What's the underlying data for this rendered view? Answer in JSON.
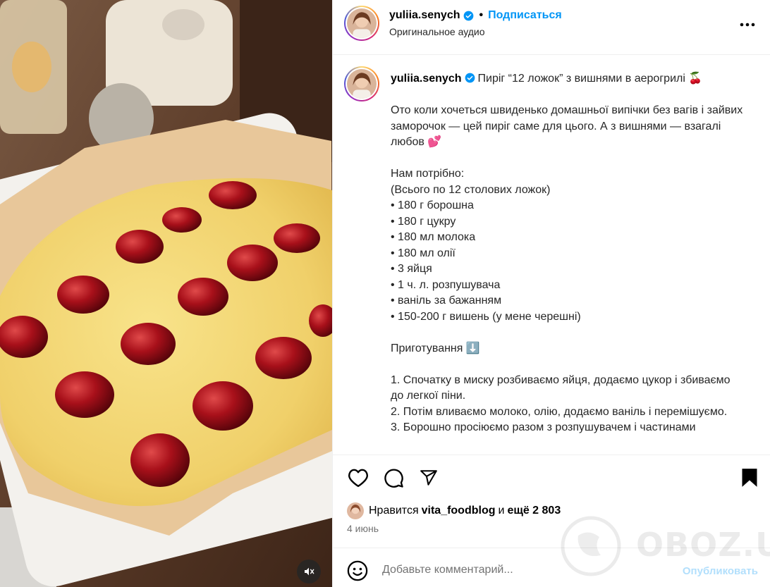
{
  "post": {
    "username": "yuliia.senych",
    "verified": true,
    "separator": "•",
    "follow_label": "Подписаться",
    "audio_label": "Оригинальное аудио",
    "more_icon": "more-horizontal-icon"
  },
  "caption": {
    "username": "yuliia.senych",
    "title": "Пиріг “12 ложок” з вишнями в аерогрилі 🍒",
    "intro": "Ото коли хочеться швиденько домашньої випічки без вагів і зайвих заморочок — цей пиріг саме для цього. А з вишнями — взагалі любов 💕",
    "need_label": "Нам потрібно:",
    "need_note": "(Всього по 12 столових ложок)",
    "ingredients": [
      "• 180 г борошна",
      "• 180 г цукру",
      "• 180 мл молока",
      "• 180 мл олії",
      "• 3 яйця",
      "• 1 ч. л. розпушувача",
      "• ваніль за бажанням",
      "• 150-200 г вишень (у мене черешні)"
    ],
    "prep_label": "Приготування ⬇️",
    "steps": [
      "1. Спочатку в миску розбиваємо яйця, додаємо цукор і збиваємо до легкої піни.",
      "2. Потім вливаємо молоко, олію, додаємо ваніль і перемішуємо.",
      "3. Борошно просіюємо разом з розпушувачем і частинами"
    ]
  },
  "actions": {
    "like_icon": "heart-icon",
    "comment_icon": "comment-icon",
    "share_icon": "share-icon",
    "save_icon": "bookmark-icon"
  },
  "likes": {
    "prefix": "Нравится",
    "liker": "vita_foodblog",
    "joiner": "и",
    "others": "ещё 2 803"
  },
  "date": "4 июнь",
  "comment": {
    "placeholder": "Добавьте комментарий...",
    "publish_label": "Опубликовать"
  },
  "media": {
    "mute_icon": "speaker-muted-icon"
  },
  "watermark": {
    "text": "OBOZ.UA"
  },
  "colors": {
    "link_blue": "#0095f6",
    "publish_disabled": "#b2dffc",
    "verified_blue": "#0095f6",
    "muted_text": "#737373"
  }
}
